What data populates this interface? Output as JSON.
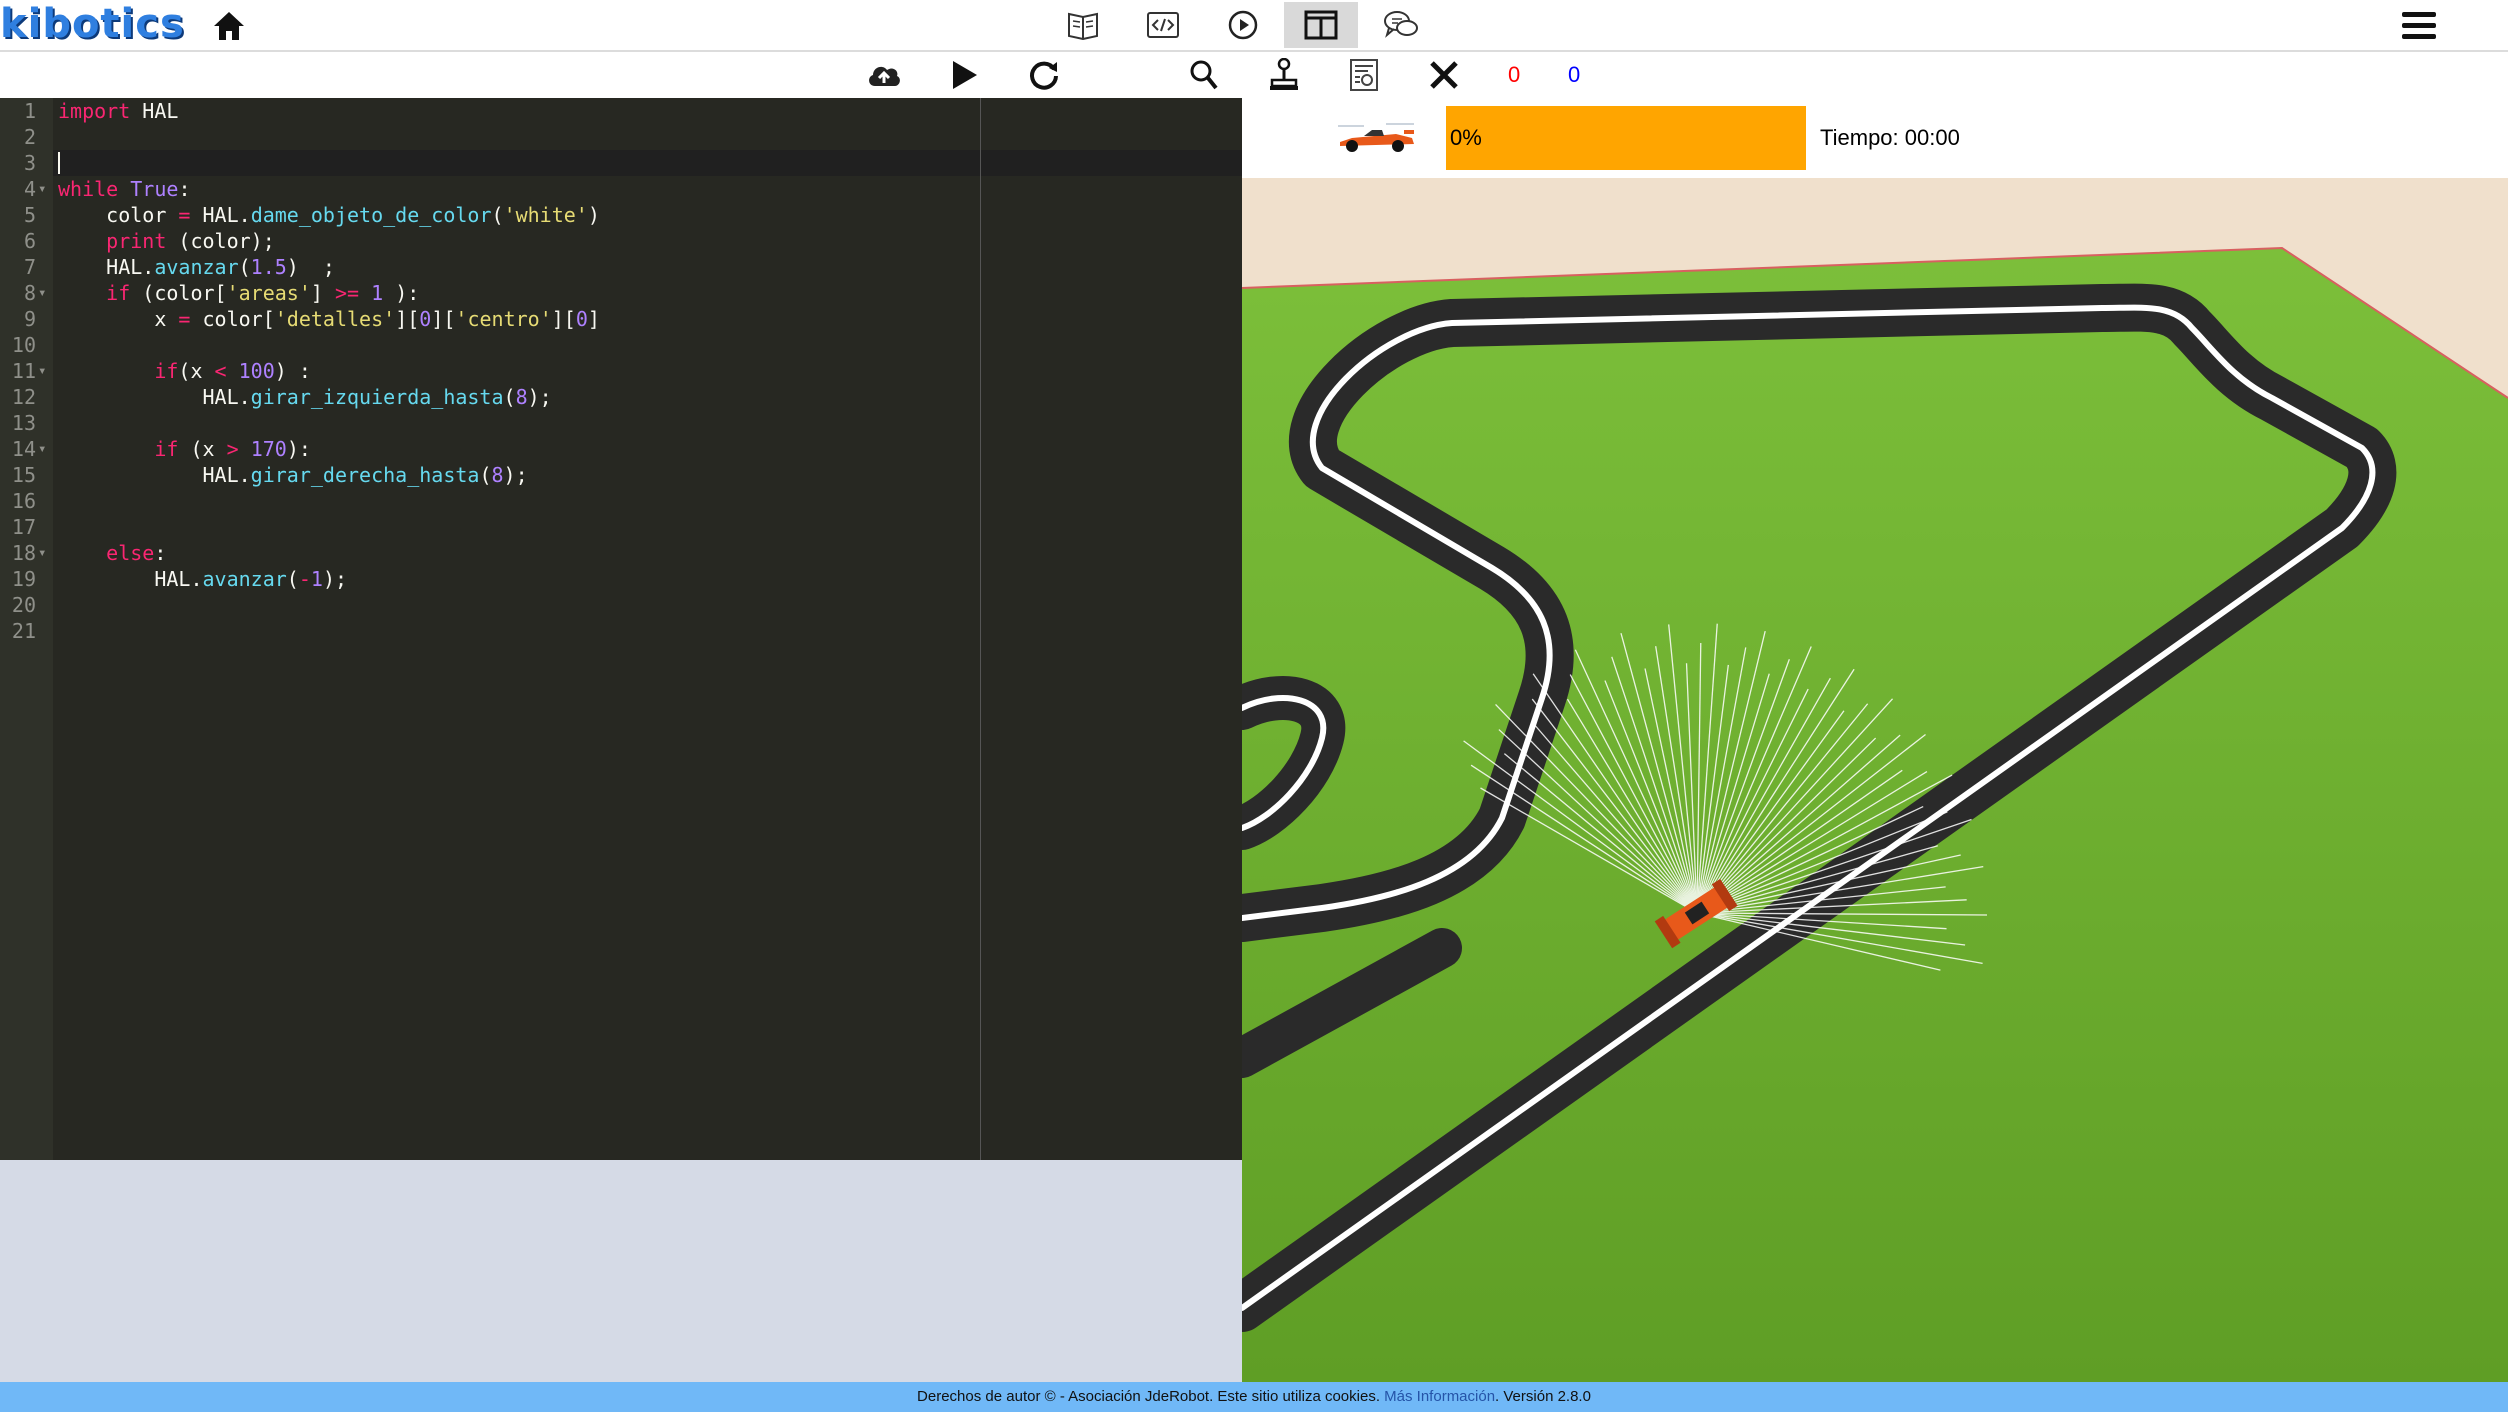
{
  "header": {
    "logo_text": "kibotics",
    "home_icon": "home-icon",
    "nav_icons": [
      "book-icon",
      "code-icon",
      "play-circle-icon",
      "split-view-icon",
      "chat-icon"
    ],
    "menu_icon": "hamburger-menu-icon"
  },
  "toolbar": {
    "icons": [
      "upload-cloud-icon",
      "play-icon",
      "reset-icon",
      "search-icon",
      "joystick-icon",
      "evaluator-icon",
      "close-icon"
    ],
    "count_red": "0",
    "count_blue": "0",
    "count_red_color": "#ff0000",
    "count_blue_color": "#0000ff"
  },
  "editor": {
    "lines": [
      {
        "n": "1",
        "fold": false
      },
      {
        "n": "2",
        "fold": false
      },
      {
        "n": "3",
        "fold": false
      },
      {
        "n": "4",
        "fold": true
      },
      {
        "n": "5",
        "fold": false
      },
      {
        "n": "6",
        "fold": false
      },
      {
        "n": "7",
        "fold": false
      },
      {
        "n": "8",
        "fold": true
      },
      {
        "n": "9",
        "fold": false
      },
      {
        "n": "10",
        "fold": false
      },
      {
        "n": "11",
        "fold": true
      },
      {
        "n": "12",
        "fold": false
      },
      {
        "n": "13",
        "fold": false
      },
      {
        "n": "14",
        "fold": true
      },
      {
        "n": "15",
        "fold": false
      },
      {
        "n": "16",
        "fold": false
      },
      {
        "n": "17",
        "fold": false
      },
      {
        "n": "18",
        "fold": true
      },
      {
        "n": "19",
        "fold": false
      },
      {
        "n": "20",
        "fold": false
      },
      {
        "n": "21",
        "fold": false
      }
    ],
    "code": {
      "l1_import": "import",
      "l1_mod": " HAL",
      "l4_while": "while",
      "l4_true": "True",
      "l4_colon": ":",
      "l5_a": "    color ",
      "l5_eq": "=",
      "l5_b": " HAL.",
      "l5_fn": "dame_objeto_de_color",
      "l5_c": "(",
      "l5_str": "'white'",
      "l5_d": ")",
      "l6_print": "print",
      "l6_rest": " (color);",
      "l7_a": "    HAL.",
      "l7_fn": "avanzar",
      "l7_b": "(",
      "l7_num": "1.5",
      "l7_c": ")  ;",
      "l8_if": "if",
      "l8_a": " (color[",
      "l8_str": "'areas'",
      "l8_b": "] ",
      "l8_op": ">=",
      "l8_c": " ",
      "l8_num": "1",
      "l8_d": " ):",
      "l9_a": "        x ",
      "l9_eq": "=",
      "l9_b": " color[",
      "l9_str1": "'detalles'",
      "l9_c": "][",
      "l9_num1": "0",
      "l9_d": "][",
      "l9_str2": "'centro'",
      "l9_e": "][",
      "l9_num2": "0",
      "l9_f": "]",
      "l11_if": "if",
      "l11_a": "(x ",
      "l11_op": "<",
      "l11_b": " ",
      "l11_num": "100",
      "l11_c": ") :",
      "l12_a": "            HAL.",
      "l12_fn": "girar_izquierda_hasta",
      "l12_b": "(",
      "l12_num": "8",
      "l12_c": ");",
      "l14_if": "if",
      "l14_a": " (x ",
      "l14_op": ">",
      "l14_b": " ",
      "l14_num": "170",
      "l14_c": "):",
      "l15_a": "            HAL.",
      "l15_fn": "girar_derecha_hasta",
      "l15_b": "(",
      "l15_num": "8",
      "l15_c": ");",
      "l18_else": "else",
      "l18_colon": ":",
      "l19_a": "        HAL.",
      "l19_fn": "avanzar",
      "l19_b": "(",
      "l19_op": "-",
      "l19_num": "1",
      "l19_c": ");"
    }
  },
  "simulator": {
    "progress_label": "0%",
    "progress_value": 0,
    "progress_color": "#ffa500",
    "timer_text": "Tiempo: 00:00",
    "car_icon": "race-car-icon"
  },
  "footer": {
    "text": "Derechos de autor © - Asociación JdeRobot. Este sitio utiliza cookies.",
    "link": "Más Información",
    "version": ". Versión 2.8.0"
  }
}
